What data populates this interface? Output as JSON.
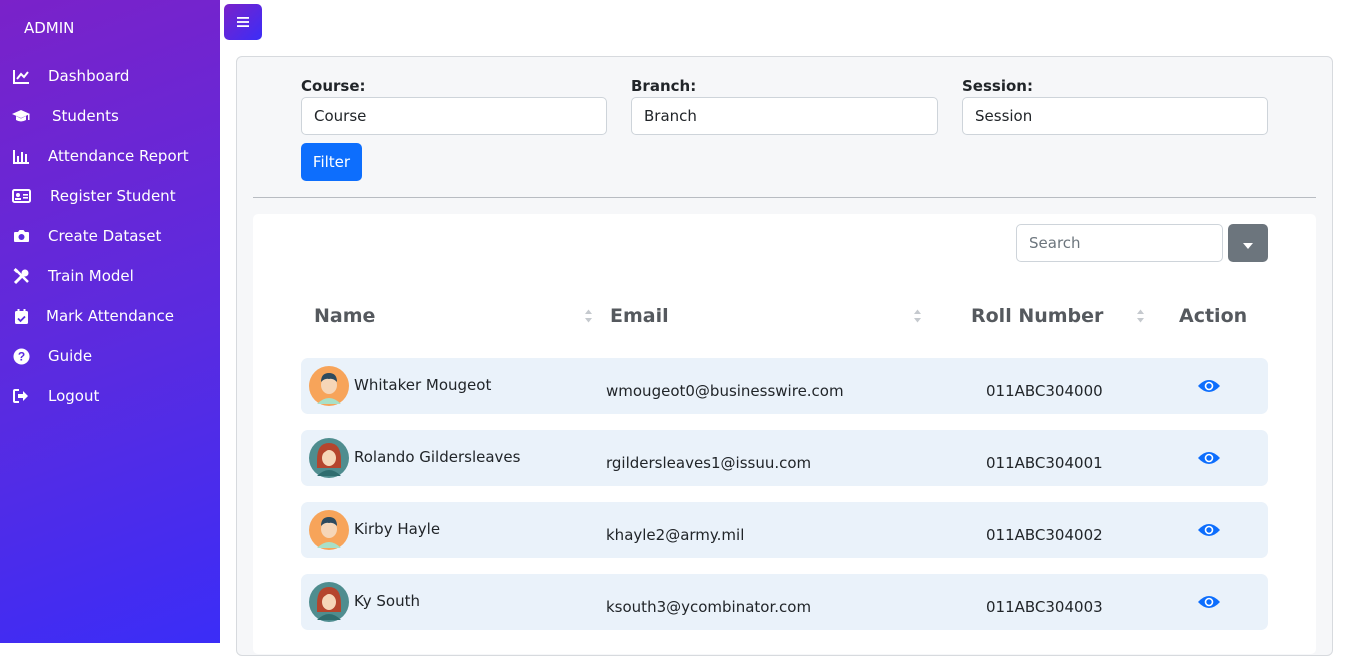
{
  "sidebar": {
    "brand": "ADMIN",
    "items": [
      {
        "label": "Dashboard",
        "icon": "chart-line-icon"
      },
      {
        "label": "Students",
        "icon": "graduation-cap-icon"
      },
      {
        "label": "Attendance Report",
        "icon": "bar-chart-icon"
      },
      {
        "label": "Register Student",
        "icon": "id-card-icon"
      },
      {
        "label": "Create Dataset",
        "icon": "camera-icon"
      },
      {
        "label": "Train Model",
        "icon": "tools-icon"
      },
      {
        "label": "Mark Attendance",
        "icon": "calendar-check-icon"
      },
      {
        "label": "Guide",
        "icon": "question-circle-icon"
      },
      {
        "label": "Logout",
        "icon": "sign-out-icon"
      }
    ]
  },
  "filters": {
    "course": {
      "label": "Course:",
      "value": "Course"
    },
    "branch": {
      "label": "Branch:",
      "value": "Branch"
    },
    "session": {
      "label": "Session:",
      "value": "Session"
    },
    "button_label": "Filter"
  },
  "search": {
    "placeholder": "Search"
  },
  "table": {
    "columns": [
      "Name",
      "Email",
      "Roll Number",
      "Action"
    ],
    "rows": [
      {
        "name": "Whitaker Mougeot",
        "email": "wmougeot0@businesswire.com",
        "roll": "011ABC304000",
        "avatar": "male"
      },
      {
        "name": "Rolando Gildersleaves",
        "email": "rgildersleaves1@issuu.com",
        "roll": "011ABC304001",
        "avatar": "female"
      },
      {
        "name": "Kirby Hayle",
        "email": "khayle2@army.mil",
        "roll": "011ABC304002",
        "avatar": "male"
      },
      {
        "name": "Ky South",
        "email": "ksouth3@ycombinator.com",
        "roll": "011ABC304003",
        "avatar": "female"
      }
    ]
  },
  "colors": {
    "sidebar_start": "#7a22c9",
    "sidebar_end": "#3b2df7",
    "primary": "#0d6efd",
    "row_bg": "#eaf2fa",
    "eye_icon": "#0d6efd"
  }
}
